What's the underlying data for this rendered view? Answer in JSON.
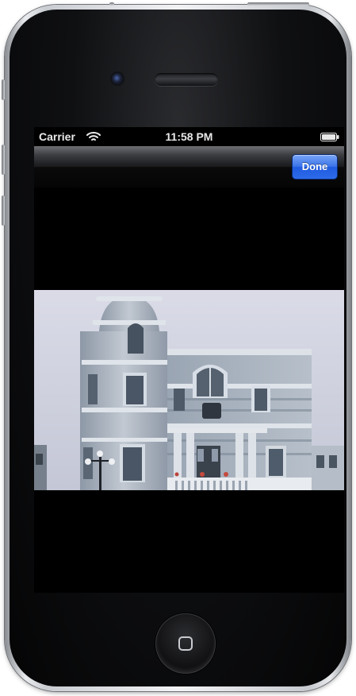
{
  "status_bar": {
    "carrier": "Carrier",
    "time": "11:58 PM",
    "wifi_icon": "wifi-icon",
    "battery_icon": "battery-icon"
  },
  "nav_bar": {
    "done_label": "Done"
  },
  "content": {
    "image": "building-photo"
  },
  "device": {
    "home_icon": "home-button-icon",
    "accent_color": "#2d6bea"
  }
}
